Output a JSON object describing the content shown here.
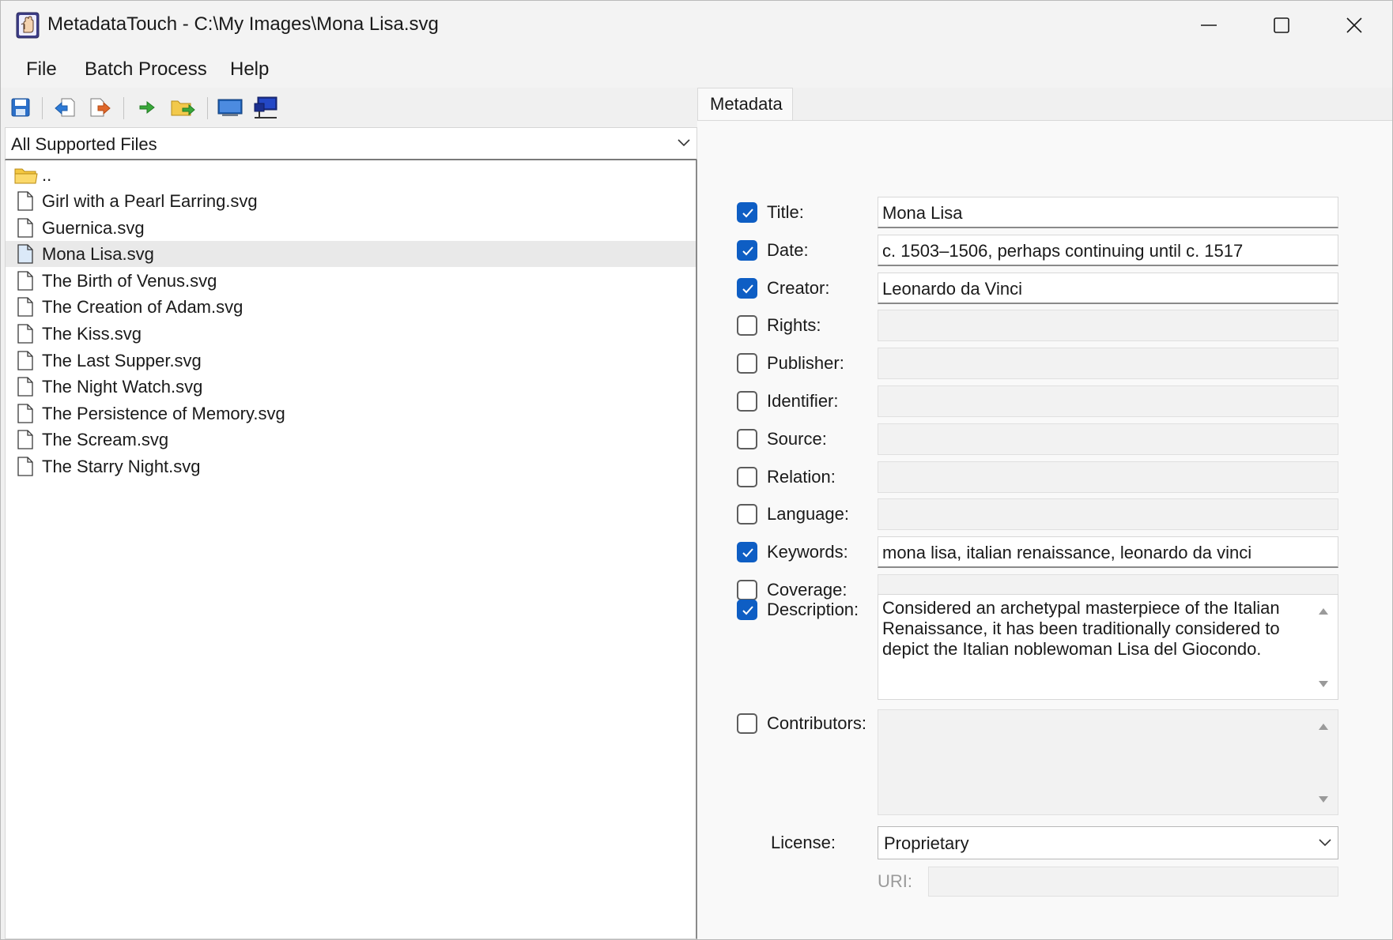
{
  "window": {
    "title": "MetadataTouch - C:\\My Images\\Mona Lisa.svg",
    "controls": [
      "minimize-icon",
      "maximize-icon",
      "close-icon"
    ]
  },
  "menu": {
    "items": [
      {
        "label": "File"
      },
      {
        "label": "Batch Process"
      },
      {
        "label": "Help"
      }
    ]
  },
  "toolbar": {
    "buttons": [
      "save-icon",
      "previous-file-icon",
      "next-file-icon",
      "go-icon",
      "open-folder-icon",
      "desktop-icon",
      "network-icon"
    ]
  },
  "file_filter": {
    "selected": "All Supported Files"
  },
  "files": {
    "parent": "..",
    "items": [
      {
        "name": "Girl with a Pearl Earring.svg",
        "selected": false
      },
      {
        "name": "Guernica.svg",
        "selected": false
      },
      {
        "name": "Mona Lisa.svg",
        "selected": true
      },
      {
        "name": "The Birth of Venus.svg",
        "selected": false
      },
      {
        "name": "The Creation of Adam.svg",
        "selected": false
      },
      {
        "name": "The Kiss.svg",
        "selected": false
      },
      {
        "name": "The Last Supper.svg",
        "selected": false
      },
      {
        "name": "The Night Watch.svg",
        "selected": false
      },
      {
        "name": "The Persistence of Memory.svg",
        "selected": false
      },
      {
        "name": "The Scream.svg",
        "selected": false
      },
      {
        "name": "The Starry Night.svg",
        "selected": false
      }
    ]
  },
  "tabs": {
    "metadata": "Metadata"
  },
  "metadata": {
    "fields": [
      {
        "label": "Title:",
        "checked": true,
        "value": "Mona Lisa"
      },
      {
        "label": "Date:",
        "checked": true,
        "value": "c. 1503–1506, perhaps continuing until c. 1517"
      },
      {
        "label": "Creator:",
        "checked": true,
        "value": "Leonardo da Vinci"
      },
      {
        "label": "Rights:",
        "checked": false,
        "value": ""
      },
      {
        "label": "Publisher:",
        "checked": false,
        "value": ""
      },
      {
        "label": "Identifier:",
        "checked": false,
        "value": ""
      },
      {
        "label": "Source:",
        "checked": false,
        "value": ""
      },
      {
        "label": "Relation:",
        "checked": false,
        "value": ""
      },
      {
        "label": "Language:",
        "checked": false,
        "value": ""
      },
      {
        "label": "Keywords:",
        "checked": true,
        "value": "mona lisa, italian renaissance, leonardo da vinci"
      },
      {
        "label": "Coverage:",
        "checked": false,
        "value": ""
      }
    ],
    "description": {
      "label": "Description:",
      "checked": true,
      "value": "Considered an archetypal masterpiece of the Italian Renaissance, it has been traditionally considered to depict the Italian noblewoman Lisa del Giocondo."
    },
    "contributors": {
      "label": "Contributors:",
      "checked": false,
      "value": ""
    },
    "license": {
      "label": "License:",
      "value": "Proprietary"
    },
    "uri": {
      "label": "URI:",
      "value": ""
    }
  },
  "colors": {
    "checkbox_checked": "#0e5ec4",
    "selected_row": "#e9e9e9"
  }
}
